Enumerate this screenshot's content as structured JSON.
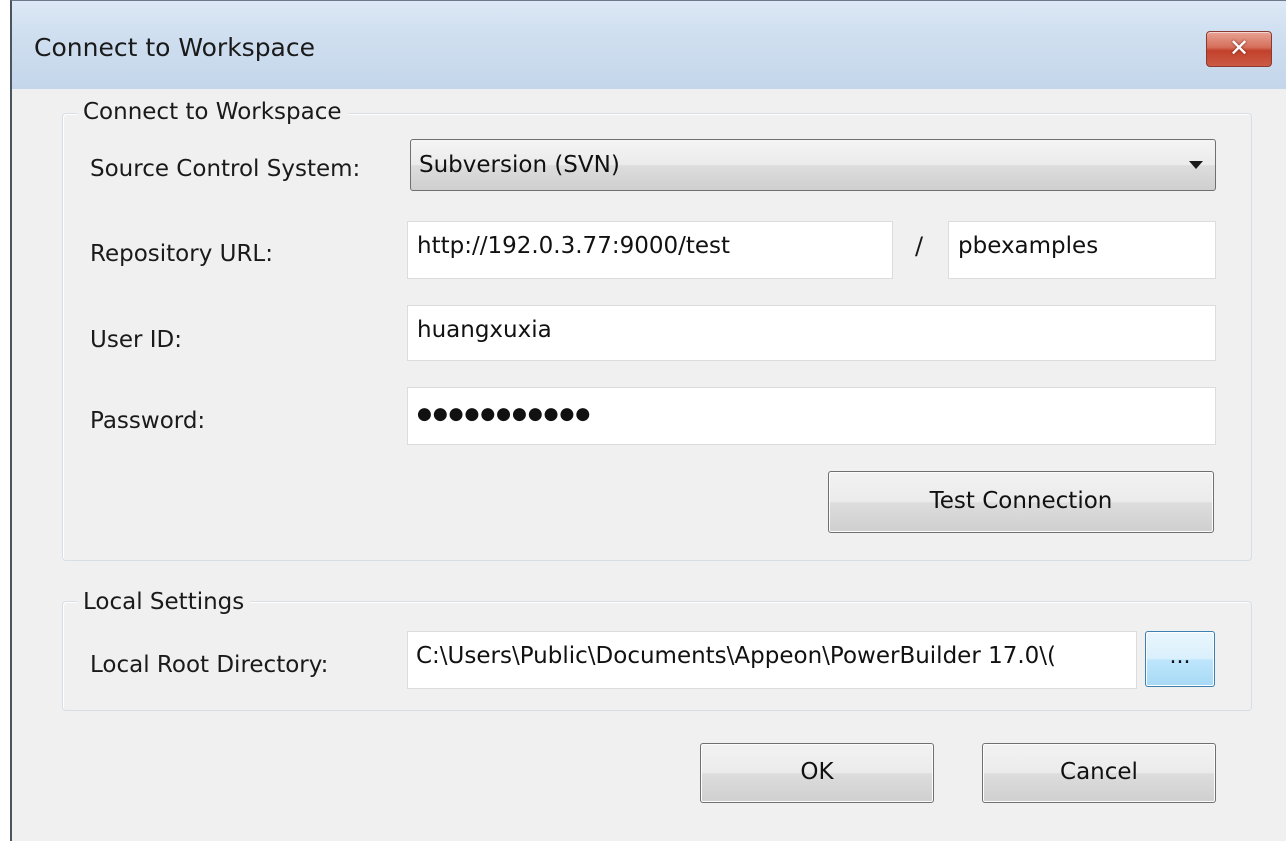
{
  "window": {
    "title": "Connect to Workspace",
    "close_glyph": "✕",
    "close_icon": "close-icon"
  },
  "workspace_group": {
    "legend": "Connect to Workspace",
    "source_control_label": "Source Control System:",
    "source_control_value": "Subversion (SVN)",
    "repository_url_label": "Repository URL:",
    "repository_url_value": "http://192.0.3.77:9000/test",
    "url_separator": "/",
    "repository_path_value": "pbexamples",
    "user_id_label": "User ID:",
    "user_id_value": "huangxuxia",
    "password_label": "Password:",
    "password_value": "●●●●●●●●●●●",
    "test_connection_label": "Test Connection"
  },
  "local_group": {
    "legend": "Local Settings",
    "root_dir_label": "Local Root Directory:",
    "root_dir_value": "C:\\Users\\Public\\Documents\\Appeon\\PowerBuilder 17.0\\(",
    "browse_label": "..."
  },
  "footer": {
    "ok_label": "OK",
    "cancel_label": "Cancel"
  },
  "colors": {
    "titlebar": "#c4d6ea",
    "close_button": "#c2412b",
    "dialog_background": "#f0f0f0",
    "browse_highlight": "#bee6fd"
  }
}
